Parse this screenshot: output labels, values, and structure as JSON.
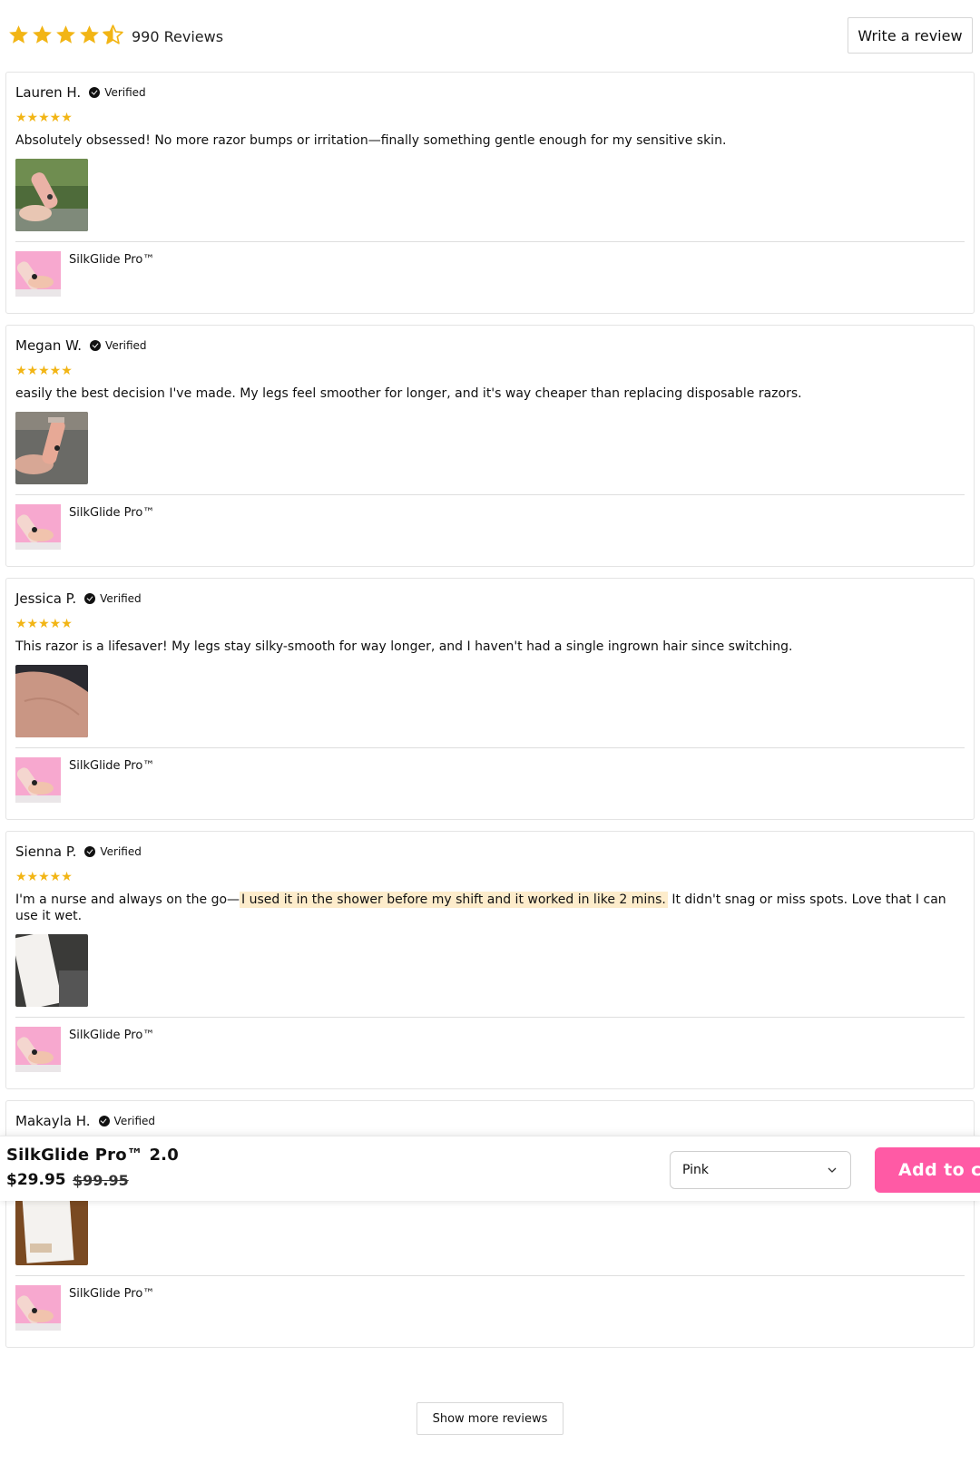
{
  "summary": {
    "rating": 4.5,
    "rating_max": 5,
    "count_label": "990 Reviews",
    "write_label": "Write a review",
    "star_color": "#f2b515"
  },
  "reviews": [
    {
      "name": "Lauren H.",
      "verified": "Verified",
      "stars": "★★★★★",
      "body": "Absolutely obsessed! No more razor bumps or irritation—finally something gentle enough for my sensitive skin.",
      "photo": "hand-holding-pink-razor-outdoors",
      "product": "SilkGlide Pro™"
    },
    {
      "name": "Megan W.",
      "verified": "Verified",
      "stars": "★★★★★",
      "body": "easily the best decision I've made. My legs feel smoother for longer, and it's way cheaper than replacing disposable razors.",
      "photo": "hand-holding-pink-razor",
      "product": "SilkGlide Pro™"
    },
    {
      "name": "Jessica P.",
      "verified": "Verified",
      "stars": "★★★★★",
      "body": "This razor is a lifesaver! My legs stay silky-smooth for way longer, and I haven't had a single ingrown hair since switching.",
      "photo": "smooth-skin-closeup",
      "product": "SilkGlide Pro™"
    },
    {
      "name": "Sienna P.",
      "verified": "Verified",
      "stars": "★★★★★",
      "body_before": "I'm a nurse and always on the go—",
      "body_highlight": "I used it in the shower before my shift and it worked in like 2 mins.",
      "body_after": " It didn't snag or miss spots. Love that I can use it wet.",
      "photo": "product-box-on-counter",
      "product": "SilkGlide Pro™"
    },
    {
      "name": "Makayla H.",
      "verified": "Verified",
      "photo": "product-box-on-wood",
      "product": "SilkGlide Pro™"
    }
  ],
  "sticky": {
    "title": "SilkGlide Pro™ 2.0",
    "price": "$29.95",
    "compare_price": "$99.95",
    "variant": "Pink",
    "cart_label": "Add to cart",
    "cart_color": "#ff5aa5"
  },
  "more_label": "Show more reviews"
}
